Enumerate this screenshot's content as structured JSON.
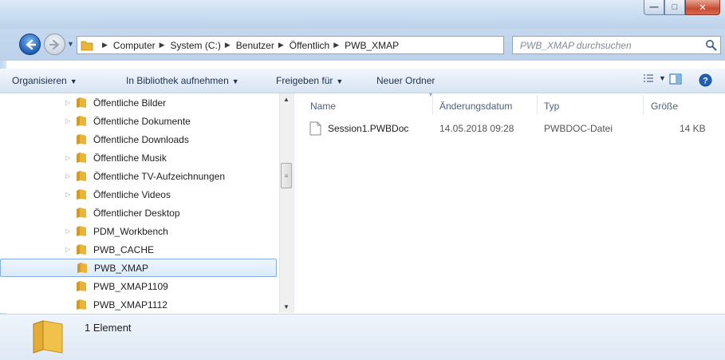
{
  "window": {
    "min_glyph": "—",
    "max_glyph": "□",
    "close_glyph": "✕"
  },
  "address_bar": {
    "crumbs": [
      "Computer",
      "System (C:)",
      "Benutzer",
      "Öffentlich",
      "PWB_XMAP"
    ]
  },
  "search": {
    "placeholder": "PWB_XMAP durchsuchen"
  },
  "toolbar": {
    "organize": "Organisieren",
    "library": "In Bibliothek aufnehmen",
    "share": "Freigeben für",
    "new_folder": "Neuer Ordner"
  },
  "nav_tree": [
    {
      "label": "Öffentliche Bilder",
      "expandable": true
    },
    {
      "label": "Öffentliche Dokumente",
      "expandable": true
    },
    {
      "label": "Öffentliche Downloads",
      "expandable": false
    },
    {
      "label": "Öffentliche Musik",
      "expandable": true
    },
    {
      "label": "Öffentliche TV-Aufzeichnungen",
      "expandable": true
    },
    {
      "label": "Öffentliche Videos",
      "expandable": true
    },
    {
      "label": "Öffentlicher Desktop",
      "expandable": false
    },
    {
      "label": "PDM_Workbench",
      "expandable": true
    },
    {
      "label": "PWB_CACHE",
      "expandable": true
    },
    {
      "label": "PWB_XMAP",
      "expandable": false,
      "selected": true
    },
    {
      "label": "PWB_XMAP1109",
      "expandable": false
    },
    {
      "label": "PWB_XMAP1112",
      "expandable": false
    }
  ],
  "file_list": {
    "columns": [
      "Name",
      "Änderungsdatum",
      "Typ",
      "Größe"
    ],
    "rows": [
      {
        "name": "Session1.PWBDoc",
        "date": "14.05.2018 09:28",
        "type": "PWBDOC-Datei",
        "size": "14 KB"
      }
    ]
  },
  "status": {
    "text": "1 Element"
  },
  "colors": {
    "folder": "#e8b53a",
    "selection_border": "#84acdd",
    "accent_blue": "#1f5fb5"
  }
}
